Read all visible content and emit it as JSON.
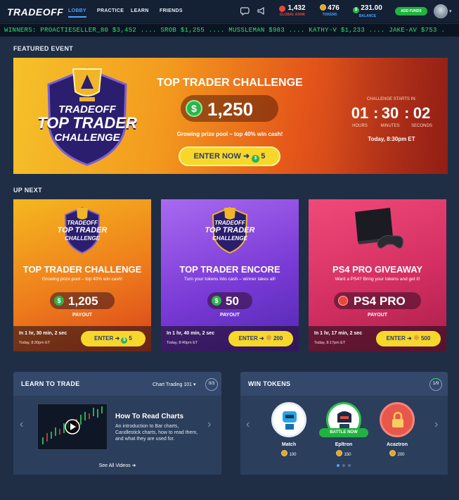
{
  "header": {
    "logo": "TRADEOFF",
    "nav": [
      {
        "label": "LOBBY",
        "active": true
      },
      {
        "label": "PRACTICE",
        "active": false
      },
      {
        "label": "LEARN",
        "active": false
      },
      {
        "label": "FRIENDS",
        "active": false
      }
    ],
    "rank": {
      "value": "1,432",
      "label": "GLOBAL RANK"
    },
    "tokens": {
      "value": "476",
      "label": "TOKENS"
    },
    "balance": {
      "value": "231.00",
      "label": "BALANCE"
    },
    "add_funds": "ADD FUNDS",
    "icons": [
      "chat-icon",
      "megaphone-icon"
    ]
  },
  "ticker": "WINNERS: PROACTIESELLER_80 $3,452 .... SROB $1,255 .... MUSSLEMAN $983 .... KATHY-V $1,233 .... JAKE-AV $753 .",
  "featured": {
    "section_title": "FEATURED EVENT",
    "logo_line1": "TRADEOFF",
    "logo_line2": "TOP TRADER",
    "logo_line3": "CHALLENGE",
    "title": "TOP TRADER CHALLENGE",
    "prize": "1,250",
    "subtitle": "Growing prize pool – top 40% win cash!",
    "enter_label": "ENTER NOW ➜",
    "entry_cost": "5",
    "countdown_label": "CHALLENGE STARTS IN:",
    "hours": "01",
    "minutes": "30",
    "seconds": "02",
    "hours_label": "HOURS",
    "minutes_label": "MINUTES",
    "seconds_label": "SECONDS",
    "start_time": "Today, 8:30pm ET"
  },
  "up_next": {
    "section_title": "UP NEXT",
    "cards": [
      {
        "title": "TOP TRADER CHALLENGE",
        "subtitle": "Growing prize pool – top 40% win cash!",
        "prize": "1,205",
        "payout_label": "PAYOUT",
        "time_left": "In 1 hr, 30 min, 2 sec",
        "date": "Today, 8:30pm ET",
        "enter_label": "ENTER ➜",
        "entry": "5",
        "logo_line1": "TRADEOFF",
        "logo_line2": "TOP TRADER",
        "logo_line3": "CHALLENGE"
      },
      {
        "title": "TOP TRADER ENCORE",
        "subtitle": "Turn your tokens into cash – winner takes all!",
        "prize": "50",
        "payout_label": "PAYOUT",
        "time_left": "In 1 hr, 40 min, 2 sec",
        "date": "Today, 8:40pm ET",
        "enter_label": "ENTER ➜",
        "entry": "200",
        "logo_line1": "TRADEOFF",
        "logo_line2": "TOP TRADER",
        "logo_line3": "CHALLENGE"
      },
      {
        "title": "PS4 PRO GIVEAWAY",
        "subtitle": "Want a PS4? Bring your tokens and get it!",
        "prize": "PS4 PRO",
        "payout_label": "PAYOUT",
        "time_left": "In 1 hr, 17 min, 2 sec",
        "date": "Today, 8:17pm ET",
        "enter_label": "ENTER ➜",
        "entry": "500"
      }
    ]
  },
  "learn": {
    "title": "LEARN TO TRADE",
    "course": "Chart Trading 101",
    "progress": "0/3",
    "video_title": "How To Read Charts",
    "video_desc": "An introduction to Bar charts, Candlestick charts, how to read them, and what they are used for.",
    "see_all": "See All Videos ➜"
  },
  "tokens": {
    "title": "WIN TOKENS",
    "progress": "1/9",
    "games": [
      {
        "name": "Match",
        "reward": "100"
      },
      {
        "name": "Epltron",
        "reward": "150",
        "badge": "BATTLE NOW"
      },
      {
        "name": "Acaztron",
        "reward": "200"
      }
    ]
  },
  "colors": {
    "accent": "#4aa3ff",
    "green": "#20b33f",
    "yellow": "#f7d72a",
    "ticker_text": "#2ee26a",
    "rank_red": "#e8473a"
  }
}
